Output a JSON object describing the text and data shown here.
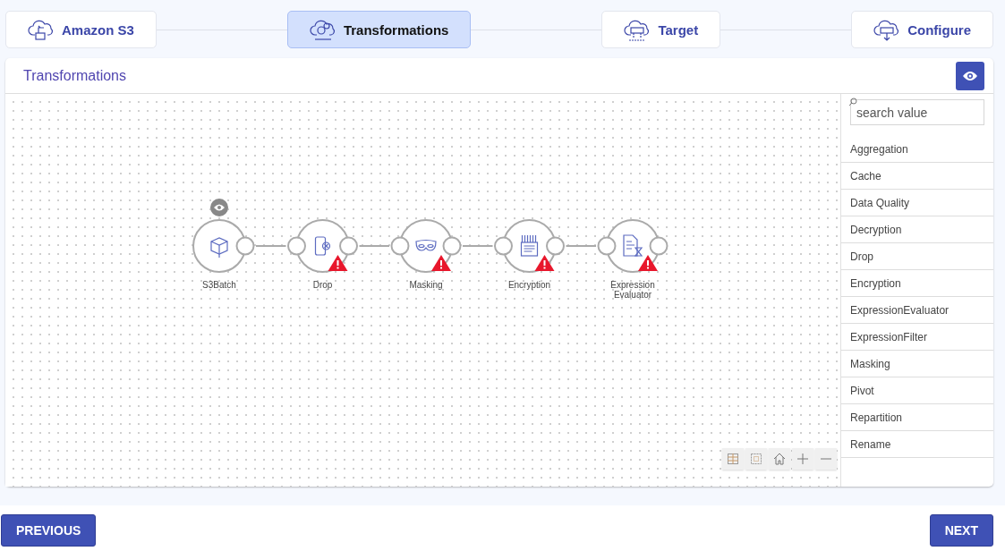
{
  "steps": [
    {
      "label": "Amazon S3",
      "kind": "source",
      "selected": false
    },
    {
      "label": "Transformations",
      "kind": "transform",
      "selected": true
    },
    {
      "label": "Target",
      "kind": "target",
      "selected": false
    },
    {
      "label": "Configure",
      "kind": "configure",
      "selected": false
    }
  ],
  "panel": {
    "title": "Transformations"
  },
  "nodes": [
    {
      "label": "S3Batch",
      "kind": "box",
      "warning": false,
      "preview": true
    },
    {
      "label": "Drop",
      "kind": "drop",
      "warning": true,
      "preview": false
    },
    {
      "label": "Masking",
      "kind": "mask",
      "warning": true,
      "preview": false
    },
    {
      "label": "Encryption",
      "kind": "encrypt",
      "warning": true,
      "preview": false
    },
    {
      "label": "Expression Evaluator",
      "kind": "expression",
      "warning": true,
      "preview": false
    }
  ],
  "search": {
    "placeholder": "search value"
  },
  "palette": [
    "Aggregation",
    "Cache",
    "Data Quality",
    "Decryption",
    "Drop",
    "Encryption",
    "ExpressionEvaluator",
    "ExpressionFilter",
    "Masking",
    "Pivot",
    "Repartition",
    "Rename"
  ],
  "footer": {
    "previous": "PREVIOUS",
    "next": "NEXT"
  }
}
